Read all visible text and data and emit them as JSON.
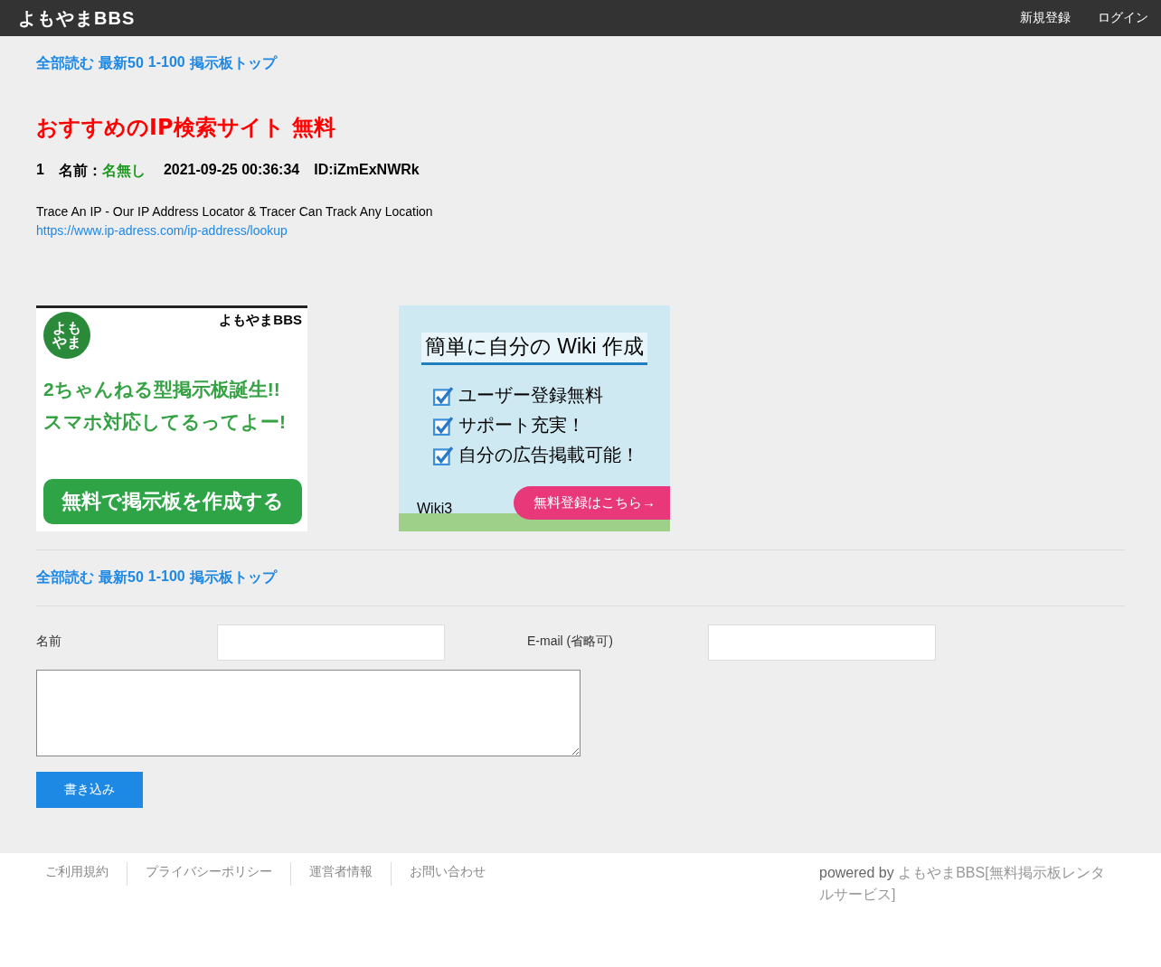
{
  "header": {
    "logo": "よもやまBBS",
    "links": [
      "新規登録",
      "ログイン"
    ]
  },
  "nav_top": [
    "全部読む",
    "最新50",
    "1-100",
    "掲示板トップ"
  ],
  "thread": {
    "title": "おすすめのIP検索サイト 無料"
  },
  "posts": [
    {
      "number": "1",
      "name_label": "名前：",
      "name": "名無し",
      "date": "2021-09-25 00:36:34",
      "id": "ID:iZmExNWRk",
      "body": "Trace An IP - Our IP Address Locator & Tracer Can Track Any Location",
      "link": "https://www.ip-adress.com/ip-address/lookup"
    }
  ],
  "banners": [
    {
      "kind": "bbs",
      "badge": "よもやま",
      "brand": "よもやまBBS",
      "headline": [
        "2ちゃんねる型掲示板誕生!!",
        "スマホ対応してるってよー!"
      ],
      "button": "無料で掲示板を作成する"
    },
    {
      "kind": "wiki",
      "headline": [
        "簡単に自分の Wiki 作成"
      ],
      "items": [
        "ユーザー登録無料",
        "サポート充実！",
        "自分の広告掲載可能！"
      ],
      "brand": "Wiki3",
      "button": "無料登録はこちら→"
    }
  ],
  "nav_bottom": [
    "全部読む",
    "最新50",
    "1-100",
    "掲示板トップ"
  ],
  "form": {
    "name_label": "名前",
    "email_label": "E-mail (省略可)",
    "submit": "書き込み"
  },
  "footer": {
    "links": [
      "ご利用規約",
      "プライバシーポリシー",
      "運営者情報",
      "お問い合わせ"
    ],
    "powered_prefix": "powered by",
    "powered_link": "よもやまBBS[無料掲示板レンタルサービス]"
  }
}
